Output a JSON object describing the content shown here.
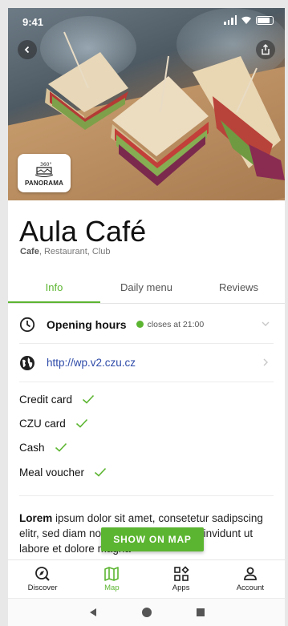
{
  "status_bar": {
    "time": "9:41"
  },
  "hero": {
    "panorama_label": "PANORAMA",
    "panorama_badge": "360°"
  },
  "venue": {
    "name": "Aula Café",
    "category_primary": "Cafe",
    "category_rest": ", Restaurant, Club"
  },
  "tabs": [
    {
      "label": "Info",
      "active": true
    },
    {
      "label": "Daily menu",
      "active": false
    },
    {
      "label": "Reviews",
      "active": false
    }
  ],
  "hours": {
    "title": "Opening hours",
    "status": "closes at 21:00",
    "status_color": "#5cb531"
  },
  "website": {
    "url": "http://wp.v2.czu.cz"
  },
  "payments": [
    {
      "label": "Credit card"
    },
    {
      "label": "CZU card"
    },
    {
      "label": "Cash"
    },
    {
      "label": "Meal voucher"
    }
  ],
  "description": {
    "lead": "Lorem",
    "text": " ipsum dolor sit amet, consetetur sadipscing elitr, sed diam nonumy eirmod tempor invidunt ut labore et dolore magna"
  },
  "show_map_label": "SHOW ON MAP",
  "bottom_nav": [
    {
      "label": "Discover",
      "icon": "discover-icon",
      "active": false
    },
    {
      "label": "Map",
      "icon": "map-icon",
      "active": true
    },
    {
      "label": "Apps",
      "icon": "apps-icon",
      "active": false
    },
    {
      "label": "Account",
      "icon": "account-icon",
      "active": false
    }
  ],
  "colors": {
    "accent": "#5cb531",
    "link": "#2d4aa8"
  }
}
